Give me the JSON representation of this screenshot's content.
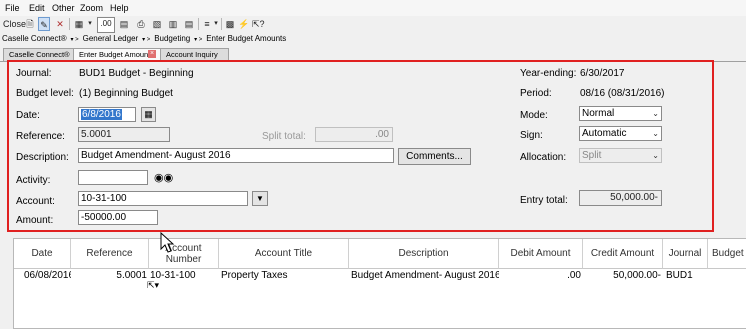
{
  "menu": [
    "File",
    "Edit",
    "Other",
    "Zoom",
    "Help"
  ],
  "toolbar": {
    "close_label": "Close",
    "decimal_label": ".00"
  },
  "breadcrumb": [
    "Caselle Connect®",
    "General Ledger",
    "Budgeting",
    "Enter Budget Amounts"
  ],
  "tabs": [
    {
      "label": "Caselle Connect®"
    },
    {
      "label": "Enter Budget Amounts",
      "active": true
    },
    {
      "label": "Account Inquiry"
    }
  ],
  "form": {
    "journal": {
      "label": "Journal:",
      "value": "BUD1  Budget - Beginning"
    },
    "budget_level": {
      "label": "Budget level:",
      "value": "(1) Beginning Budget"
    },
    "date": {
      "label": "Date:",
      "value": "6/8/2016"
    },
    "reference": {
      "label": "Reference:",
      "value": "5.0001"
    },
    "split_total": {
      "label": "Split total:",
      "value": ".00"
    },
    "description": {
      "label": "Description:",
      "value": "Budget Amendment- August 2016"
    },
    "comments_button": "Comments...",
    "activity": {
      "label": "Activity:",
      "value": ""
    },
    "account": {
      "label": "Account:",
      "value": "10-31-100"
    },
    "amount": {
      "label": "Amount:",
      "value": "-50000.00"
    },
    "year_ending": {
      "label": "Year-ending:",
      "value": "6/30/2017"
    },
    "period": {
      "label": "Period:",
      "value": "08/16 (08/31/2016)"
    },
    "mode": {
      "label": "Mode:",
      "value": "Normal"
    },
    "sign": {
      "label": "Sign:",
      "value": "Automatic"
    },
    "allocation": {
      "label": "Allocation:",
      "value": "Split"
    },
    "entry_total": {
      "label": "Entry total:",
      "value": "50,000.00-"
    }
  },
  "grid": {
    "columns": [
      "Date",
      "Reference",
      "Account\nNumber",
      "Account Title",
      "Description",
      "Debit Amount",
      "Credit Amount",
      "Journal",
      "Budget"
    ],
    "rows": [
      [
        "06/08/2016",
        "5.0001",
        "10-31-100",
        "Property Taxes",
        "Budget Amendment- August 2016",
        ".00",
        "50,000.00-",
        "BUD1",
        ""
      ]
    ]
  }
}
